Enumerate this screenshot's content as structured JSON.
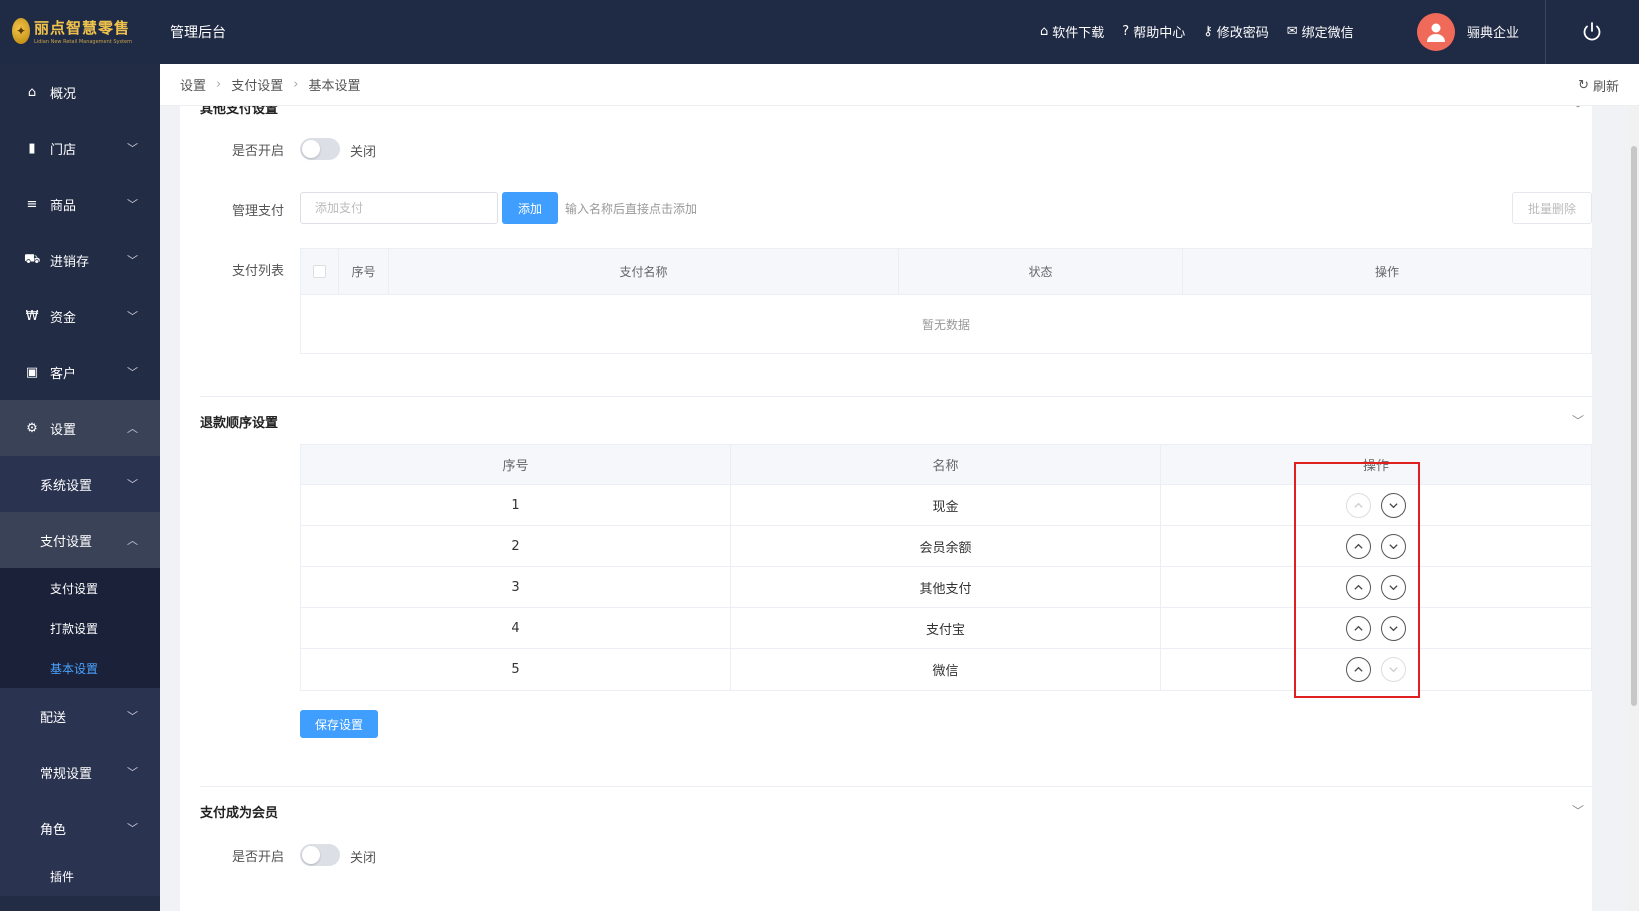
{
  "header": {
    "logo_title": "丽点智慧零售",
    "logo_sub": "Lidian New Retail Management System",
    "admin_title": "管理后台",
    "links": [
      {
        "icon": "store-icon",
        "glyph": "⌂",
        "label": "软件下载"
      },
      {
        "icon": "help-icon",
        "glyph": "?",
        "label": "帮助中心"
      },
      {
        "icon": "key-icon",
        "glyph": "⚷",
        "label": "修改密码"
      },
      {
        "icon": "wechat-icon",
        "glyph": "✉",
        "label": "绑定微信"
      }
    ],
    "company": "骊典企业"
  },
  "sidebar": {
    "items": [
      {
        "label": "概况",
        "glyph": "⌂"
      },
      {
        "label": "门店",
        "glyph": "▮"
      },
      {
        "label": "商品",
        "glyph": "≡"
      },
      {
        "label": "进销存",
        "glyph": "⛟"
      },
      {
        "label": "资金",
        "glyph": "₩"
      },
      {
        "label": "客户",
        "glyph": "▣"
      },
      {
        "label": "设置",
        "glyph": "⚙"
      }
    ],
    "settings_sub": [
      {
        "label": "系统设置"
      },
      {
        "label": "支付设置"
      }
    ],
    "payment_leaves": [
      "支付设置",
      "打款设置",
      "基本设置"
    ],
    "more_sub": [
      "配送",
      "常规设置",
      "角色"
    ],
    "plugin": "插件"
  },
  "breadcrumb": {
    "items": [
      "设置",
      "支付设置",
      "基本设置"
    ],
    "refresh": "刷新"
  },
  "other_pay": {
    "title": "其他支付设置",
    "enable_label": "是否开启",
    "enable_state": "关闭",
    "manage_label": "管理支付",
    "input_placeholder": "添加支付",
    "add_button": "添加",
    "hint": "输入名称后直接点击添加",
    "batch_delete": "批量删除",
    "list_label": "支付列表",
    "columns": [
      "序号",
      "支付名称",
      "状态",
      "操作"
    ],
    "empty_text": "暂无数据"
  },
  "refund_order": {
    "title": "退款顺序设置",
    "columns": [
      "序号",
      "名称",
      "操作"
    ],
    "rows": [
      {
        "no": "1",
        "name": "现金"
      },
      {
        "no": "2",
        "name": "会员余额"
      },
      {
        "no": "3",
        "name": "其他支付"
      },
      {
        "no": "4",
        "name": "支付宝"
      },
      {
        "no": "5",
        "name": "微信"
      }
    ],
    "save_button": "保存设置"
  },
  "member_pay": {
    "title": "支付成为会员",
    "enable_label": "是否开启",
    "enable_state": "关闭"
  },
  "colors": {
    "topbar": "#1f2a44",
    "sidebar": "#222c45",
    "primary": "#409eff",
    "active_leaf": "#4aa3ff",
    "highlight": "#e02020"
  }
}
